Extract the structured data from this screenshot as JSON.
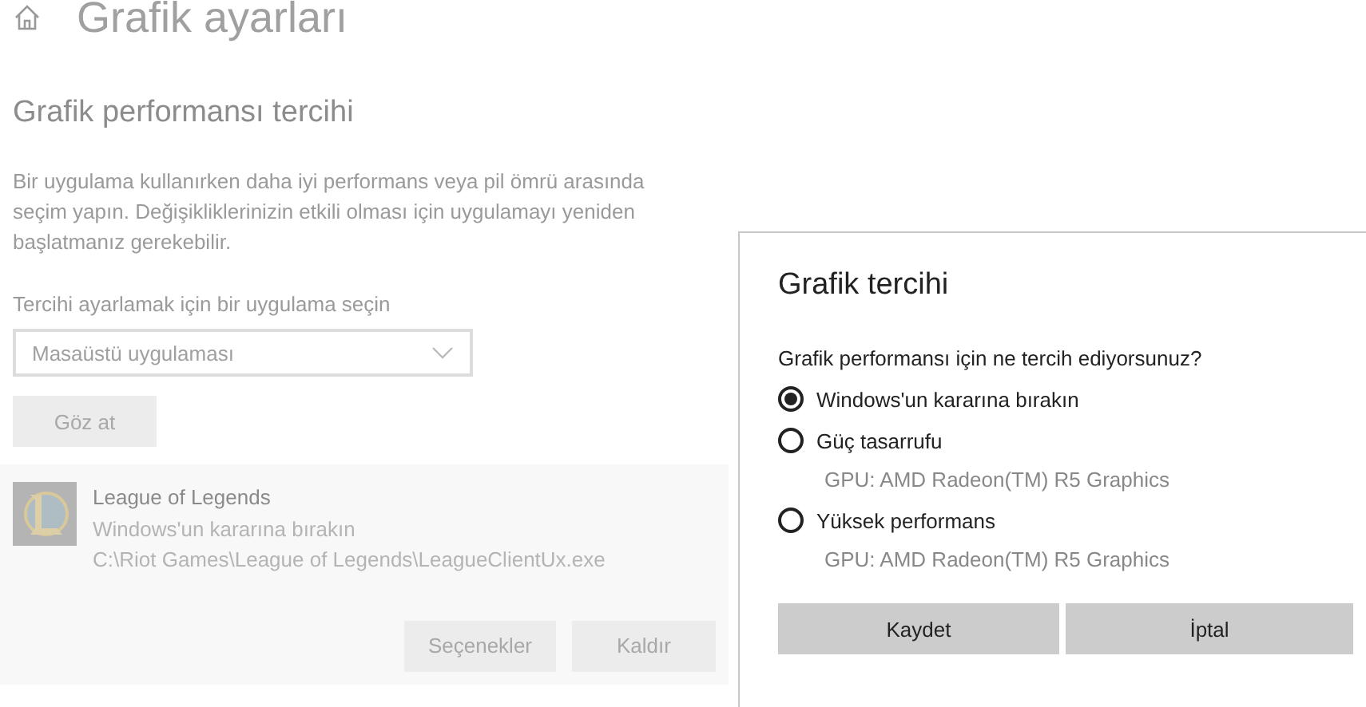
{
  "page": {
    "title": "Grafik ayarları",
    "section_title": "Grafik performansı tercihi",
    "description": "Bir uygulama kullanırken daha iyi performans veya pil ömrü arasında seçim yapın. Değişikliklerinizin etkili olması için uygulamayı yeniden başlatmanız gerekebilir.",
    "app_type_label": "Tercihi ayarlamak için bir uygulama seçin",
    "app_type_value": "Masaüstü uygulaması",
    "browse_button": "Göz at"
  },
  "apps": [
    {
      "name": "League of Legends",
      "preference": "Windows'un kararına bırakın",
      "path": "C:\\Riot Games\\League of Legends\\LeagueClientUx.exe",
      "buttons": [
        "Seçenekler",
        "Kaldır"
      ]
    }
  ],
  "dialog": {
    "title": "Grafik tercihi",
    "question": "Grafik performansı için ne tercih ediyorsunuz?",
    "options": [
      {
        "label": "Windows'un kararına bırakın",
        "selected": true
      },
      {
        "label": "Güç tasarrufu",
        "gpu": "GPU: AMD Radeon(TM) R5 Graphics",
        "selected": false
      },
      {
        "label": "Yüksek performans",
        "gpu": "GPU: AMD Radeon(TM) R5 Graphics",
        "selected": false
      }
    ],
    "buttons": [
      "Kaydet",
      "İptal"
    ]
  }
}
